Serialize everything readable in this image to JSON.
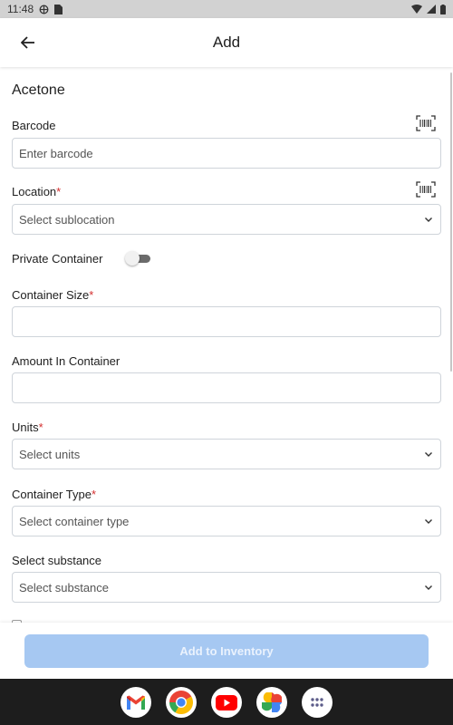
{
  "status_bar": {
    "time": "11:48"
  },
  "app_bar": {
    "title": "Add"
  },
  "chemical": {
    "name": "Acetone"
  },
  "form": {
    "barcode": {
      "label": "Barcode",
      "placeholder": "Enter barcode",
      "value": ""
    },
    "location": {
      "label": "Location",
      "required": "*",
      "selected": "Select sublocation"
    },
    "private_container": {
      "label": "Private Container",
      "enabled": false
    },
    "container_size": {
      "label": "Container Size",
      "required": "*",
      "value": ""
    },
    "amount_in_container": {
      "label": "Amount In Container",
      "value": ""
    },
    "units": {
      "label": "Units",
      "required": "*",
      "selected": "Select units"
    },
    "container_type": {
      "label": "Container Type",
      "required": "*",
      "selected": "Select container type"
    },
    "substance": {
      "label": "Select substance",
      "selected": "Select substance"
    }
  },
  "actions": {
    "add_label": "Add to Inventory",
    "enabled": false
  },
  "dock": {
    "apps": [
      "gmail-icon",
      "chrome-icon",
      "youtube-icon",
      "photos-icon",
      "app-drawer-icon"
    ]
  },
  "colors": {
    "required": "#d32f2f",
    "primary_disabled": "#a6c8f2",
    "status_bar": "#d2d2d2",
    "nav_bar": "#1d1d1d"
  }
}
